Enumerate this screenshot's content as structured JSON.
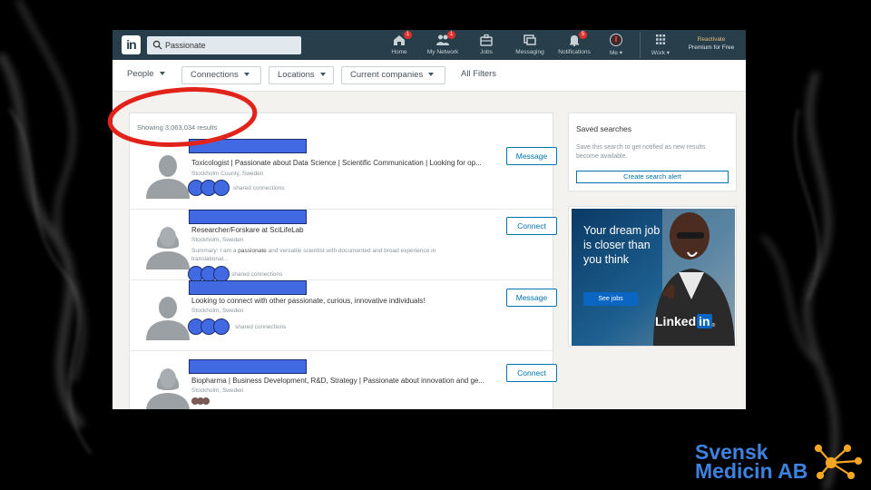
{
  "nav": {
    "logo": "in",
    "search_value": "Passionate",
    "items": [
      {
        "label": "Home",
        "icon": "home-icon",
        "badge": "1"
      },
      {
        "label": "My Network",
        "icon": "network-icon",
        "badge": "1"
      },
      {
        "label": "Jobs",
        "icon": "briefcase-icon",
        "badge": ""
      },
      {
        "label": "Messaging",
        "icon": "messaging-icon",
        "badge": ""
      },
      {
        "label": "Notifications",
        "icon": "bell-icon",
        "badge": "5"
      },
      {
        "label": "Me",
        "icon": "avatar-icon",
        "badge": ""
      },
      {
        "label": "Work",
        "icon": "grid-icon",
        "badge": ""
      }
    ],
    "premium_line1": "Reactivate",
    "premium_line2": "Premium for Free"
  },
  "filters": {
    "people": "People",
    "connections": "Connections",
    "locations": "Locations",
    "current_companies": "Current companies",
    "all_filters": "All Filters"
  },
  "results": {
    "showing": "Showing 3,063,034 results",
    "rows": [
      {
        "headline": "Toxicologist | Passionate about Data Science | Scientific Communication | Looking for op...",
        "location": "Stockholm County, Sweden",
        "summary": "",
        "shared": "shared connections",
        "action": "Message",
        "gender": "male"
      },
      {
        "headline": "Researcher/Forskare at SciLifeLab",
        "location": "Stockholm, Sweden",
        "summary_prefix": "Summary: I am a ",
        "summary_bold": "passionate",
        "summary_suffix": " and versatile scientist with documented and broad experience in translational...",
        "shared": "shared connections",
        "action": "Connect",
        "gender": "female"
      },
      {
        "headline": "Looking to connect with other passionate, curious, innovative individuals!",
        "location": "Stockholm, Sweden",
        "summary": "",
        "shared": "shared connections",
        "action": "Message",
        "gender": "male"
      },
      {
        "headline": "Biopharma | Business Development, R&D, Strategy | Passionate about innovation and ge...",
        "location": "Stockholm, Sweden",
        "summary": "",
        "shared": "",
        "action": "Connect",
        "gender": "female"
      }
    ]
  },
  "saved_searches": {
    "title": "Saved searches",
    "description": "Save this search to get notified as new results become available.",
    "button": "Create search alert"
  },
  "ad": {
    "headline": "Your dream job is closer than you think",
    "button": "See jobs",
    "logo_text": "Linked",
    "logo_in": "in",
    "logo_tm": "®"
  },
  "brand": {
    "line1": "Svensk",
    "line2": "Medicin AB"
  },
  "colors": {
    "nav_bg": "#283e4a",
    "accent": "#0073b1",
    "redaction_blue": "#4169e1",
    "highlight_red": "#e2231a",
    "brand_blue": "#3e82e0",
    "brand_orange": "#f5a623"
  }
}
